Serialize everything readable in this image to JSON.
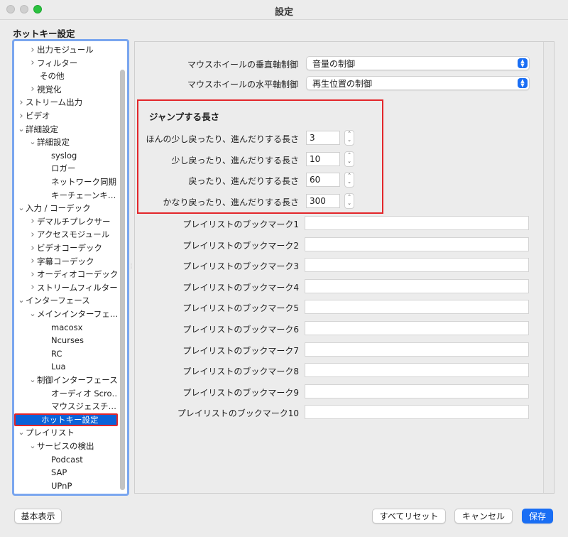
{
  "window": {
    "title": "設定"
  },
  "heading": "ホットキー設定",
  "tree": [
    {
      "label": "出力モジュール",
      "level": 1,
      "chevron": "right"
    },
    {
      "label": "フィルター",
      "level": 1,
      "chevron": "right"
    },
    {
      "label": "その他",
      "level": 1,
      "chevron": ""
    },
    {
      "label": "視覚化",
      "level": 1,
      "chevron": "right"
    },
    {
      "label": "ストリーム出力",
      "level": 0,
      "chevron": "right"
    },
    {
      "label": "ビデオ",
      "level": 0,
      "chevron": "right"
    },
    {
      "label": "詳細設定",
      "level": 0,
      "chevron": "down"
    },
    {
      "label": "詳細設定",
      "level": 1,
      "chevron": "down"
    },
    {
      "label": "syslog",
      "level": 2,
      "chevron": ""
    },
    {
      "label": "ロガー",
      "level": 2,
      "chevron": ""
    },
    {
      "label": "ネットワーク同期",
      "level": 2,
      "chevron": ""
    },
    {
      "label": "キーチェーンキ…",
      "level": 2,
      "chevron": ""
    },
    {
      "label": "入力 / コーデック",
      "level": 0,
      "chevron": "down"
    },
    {
      "label": "デマルチプレクサー",
      "level": 1,
      "chevron": "right"
    },
    {
      "label": "アクセスモジュール",
      "level": 1,
      "chevron": "right"
    },
    {
      "label": "ビデオコーデック",
      "level": 1,
      "chevron": "right"
    },
    {
      "label": "字幕コーデック",
      "level": 1,
      "chevron": "right"
    },
    {
      "label": "オーディオコーデック",
      "level": 1,
      "chevron": "right"
    },
    {
      "label": "ストリームフィルター",
      "level": 1,
      "chevron": "right"
    },
    {
      "label": "インターフェース",
      "level": 0,
      "chevron": "down"
    },
    {
      "label": "メインインターフェ…",
      "level": 1,
      "chevron": "down"
    },
    {
      "label": "macosx",
      "level": 2,
      "chevron": ""
    },
    {
      "label": "Ncurses",
      "level": 2,
      "chevron": ""
    },
    {
      "label": "RC",
      "level": 2,
      "chevron": ""
    },
    {
      "label": "Lua",
      "level": 2,
      "chevron": ""
    },
    {
      "label": "制御インターフェース",
      "level": 1,
      "chevron": "down"
    },
    {
      "label": "オーディオ Scro…",
      "level": 2,
      "chevron": ""
    },
    {
      "label": "マウスジェスチ…",
      "level": 2,
      "chevron": ""
    },
    {
      "label": "ホットキー設定",
      "level": 1,
      "chevron": "",
      "selected": true
    },
    {
      "label": "プレイリスト",
      "level": 0,
      "chevron": "down"
    },
    {
      "label": "サービスの検出",
      "level": 1,
      "chevron": "down"
    },
    {
      "label": "Podcast",
      "level": 2,
      "chevron": ""
    },
    {
      "label": "SAP",
      "level": 2,
      "chevron": ""
    },
    {
      "label": "UPnP",
      "level": 2,
      "chevron": ""
    }
  ],
  "mouse": {
    "vertical_label": "マウスホイールの垂直軸制御",
    "vertical_value": "音量の制御",
    "horizontal_label": "マウスホイールの水平軸制御",
    "horizontal_value": "再生位置の制御"
  },
  "jump": {
    "title": "ジャンプする長さ",
    "rows": [
      {
        "label": "ほんの少し戻ったり、進んだりする長さ",
        "value": "3"
      },
      {
        "label": "少し戻ったり、進んだりする長さ",
        "value": "10"
      },
      {
        "label": "戻ったり、進んだりする長さ",
        "value": "60"
      },
      {
        "label": "かなり戻ったり、進んだりする長さ",
        "value": "300"
      }
    ]
  },
  "bookmarks": [
    {
      "label": "プレイリストのブックマーク1",
      "value": ""
    },
    {
      "label": "プレイリストのブックマーク2",
      "value": ""
    },
    {
      "label": "プレイリストのブックマーク3",
      "value": ""
    },
    {
      "label": "プレイリストのブックマーク4",
      "value": ""
    },
    {
      "label": "プレイリストのブックマーク5",
      "value": ""
    },
    {
      "label": "プレイリストのブックマーク6",
      "value": ""
    },
    {
      "label": "プレイリストのブックマーク7",
      "value": ""
    },
    {
      "label": "プレイリストのブックマーク8",
      "value": ""
    },
    {
      "label": "プレイリストのブックマーク9",
      "value": ""
    },
    {
      "label": "プレイリストのブックマーク10",
      "value": ""
    }
  ],
  "buttons": {
    "basic": "基本表示",
    "reset_all": "すべてリセット",
    "cancel": "キャンセル",
    "save": "保存"
  },
  "colors": {
    "accent": "#1a6ef4",
    "highlight_border": "#e3262a",
    "tree_focus_border": "#7aa6ef"
  }
}
